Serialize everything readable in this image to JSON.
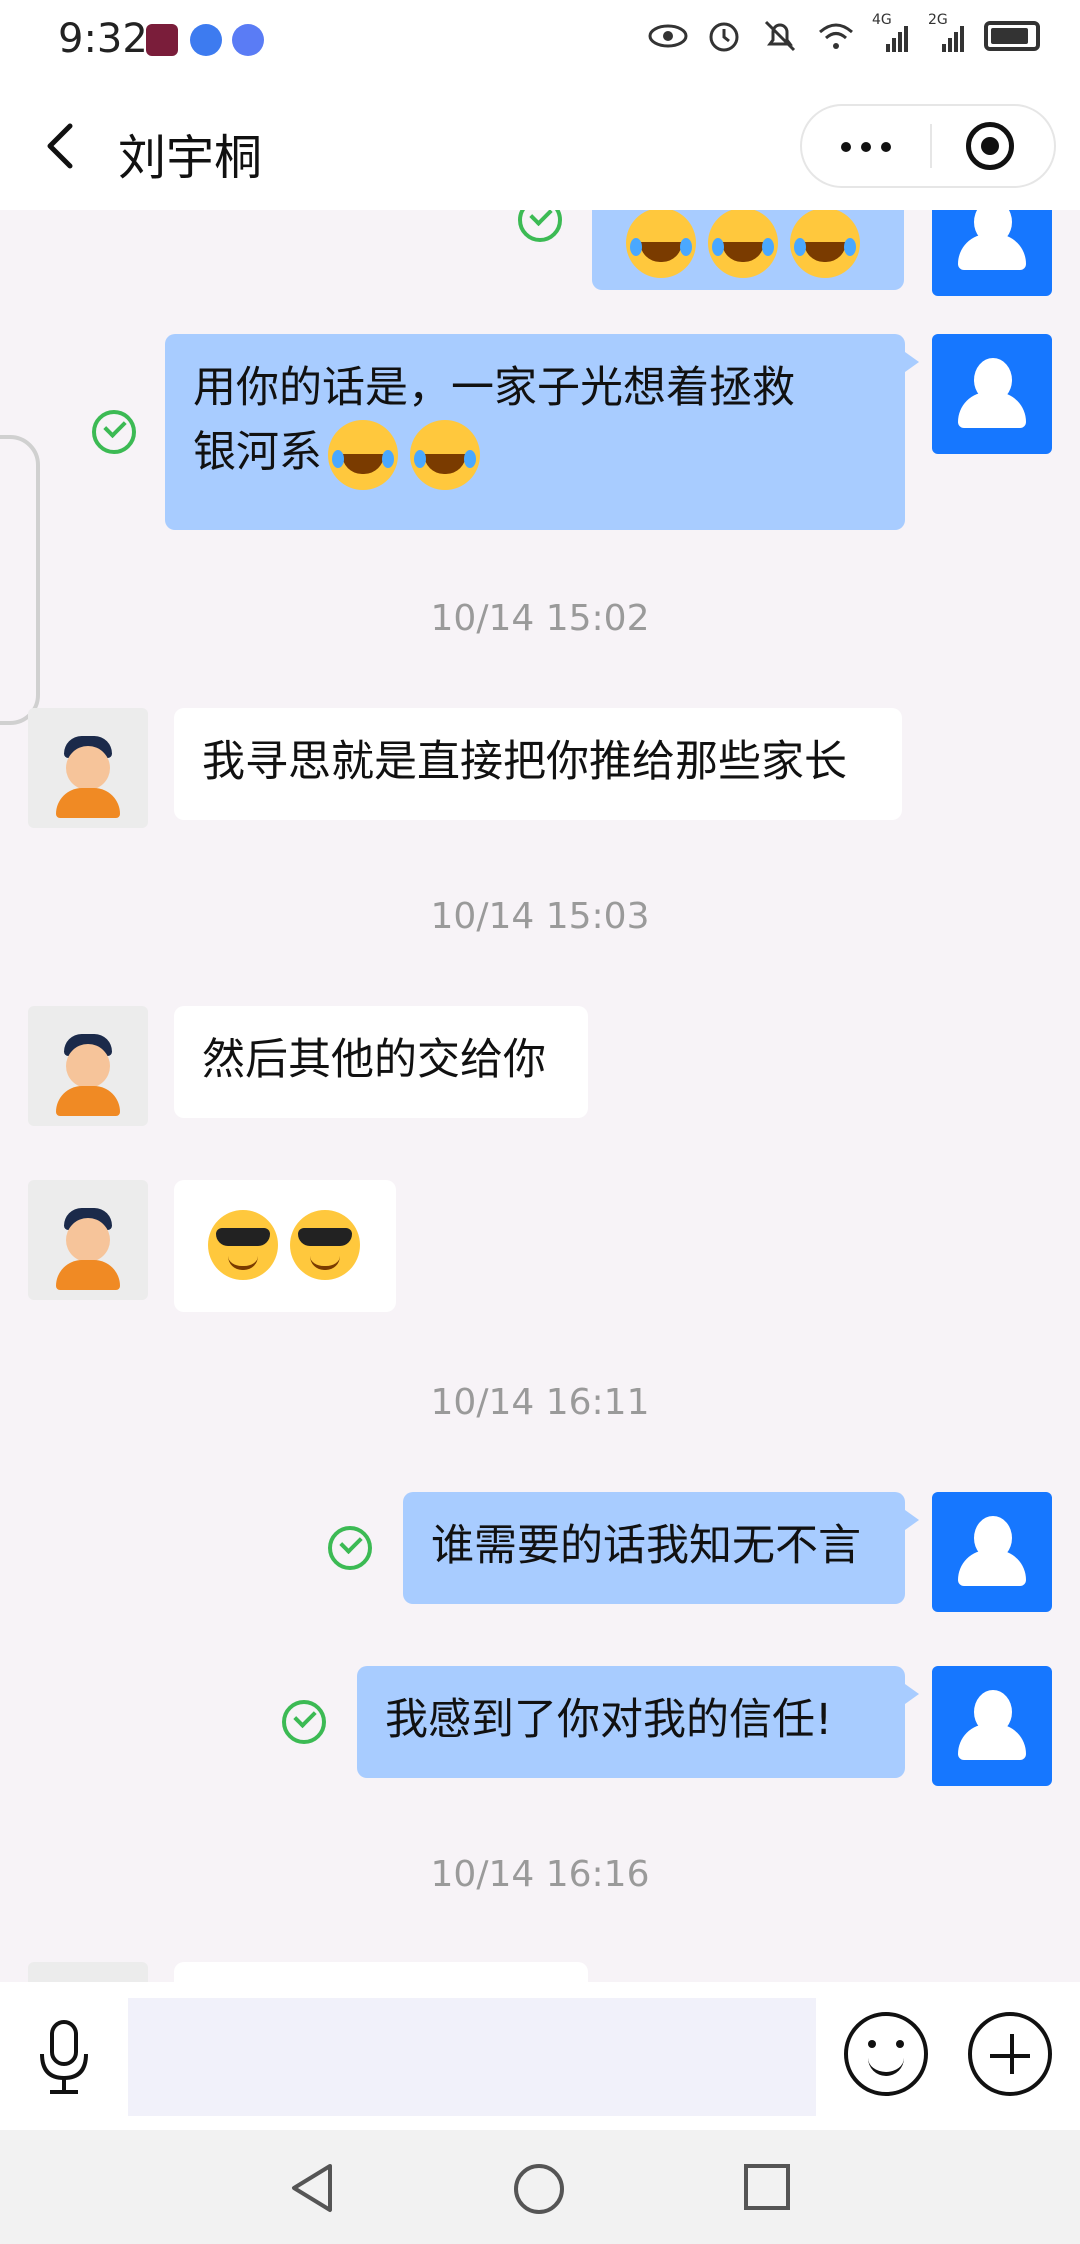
{
  "status_bar": {
    "time": "9:32",
    "network_labels": [
      "4G",
      "2G"
    ],
    "icons": [
      "app-icon-red",
      "browser-icon",
      "music-icon",
      "eye-icon",
      "alarm-icon",
      "mute-icon",
      "wifi-icon",
      "signal-4g-icon",
      "signal-2g-icon",
      "battery-icon"
    ]
  },
  "header": {
    "back_icon": "chevron-left-icon",
    "title": "刘宇桐",
    "more_icon": "more-dots-icon",
    "target_icon": "record-target-icon"
  },
  "colors": {
    "my_bubble": "#a8ccff",
    "other_bubble": "#ffffff",
    "chat_background": "#f7f3f7",
    "my_avatar": "#1677ff",
    "read_check": "#3cba54"
  },
  "messages": [
    {
      "sender": "me",
      "text": "😂😂😂",
      "partial": true
    },
    {
      "sender": "me",
      "text": "用你的话是，一家子光想着拯救银河系😂😂",
      "text_line1": "用你的话是，一家子光想着拯救",
      "text_line2": "银河系"
    },
    {
      "timestamp": "10/14 15:02"
    },
    {
      "sender": "other",
      "text": "我寻思就是直接把你推给那些家长"
    },
    {
      "timestamp": "10/14 15:03"
    },
    {
      "sender": "other",
      "text": "然后其他的交给你"
    },
    {
      "sender": "other",
      "text": "😎😎"
    },
    {
      "timestamp": "10/14 16:11"
    },
    {
      "sender": "me",
      "text": "谁需要的话我知无不言"
    },
    {
      "sender": "me",
      "text": "我感到了你对我的信任!"
    },
    {
      "timestamp": "10/14 16:16"
    }
  ],
  "input_bar": {
    "voice_icon": "microphone-icon",
    "emoji_icon": "smiley-icon",
    "plus_icon": "plus-circle-icon",
    "placeholder": ""
  },
  "system_nav": {
    "icons": [
      "back-triangle-icon",
      "home-circle-icon",
      "recents-square-icon"
    ]
  }
}
